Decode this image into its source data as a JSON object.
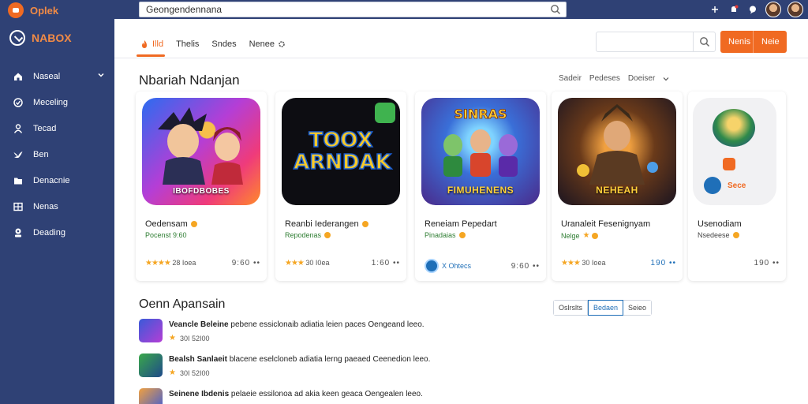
{
  "topbar": {
    "brand": "Oplek",
    "search_value": "Geongendennana",
    "icons": [
      "pin-icon",
      "bell-icon",
      "chat-icon",
      "avatar",
      "avatar"
    ]
  },
  "sidebar": {
    "brand": "NABOX",
    "items": [
      {
        "label": "Naseal",
        "icon": "house-icon",
        "caret": true
      },
      {
        "label": "Meceling",
        "icon": "circle-check-icon"
      },
      {
        "label": "Tecad",
        "icon": "people-icon"
      },
      {
        "label": "Ben",
        "icon": "bird-icon"
      },
      {
        "label": "Denacnie",
        "icon": "folder-icon"
      },
      {
        "label": "Nenas",
        "icon": "grid-icon"
      },
      {
        "label": "Deading",
        "icon": "person-icon"
      }
    ]
  },
  "header": {
    "tabs": [
      {
        "label": "Illd",
        "active": true
      },
      {
        "label": "Thelis"
      },
      {
        "label": "Sndes"
      },
      {
        "label": "Nenee"
      }
    ],
    "search_placeholder": "",
    "buttons": [
      "Nenis",
      "Neie"
    ]
  },
  "section1": {
    "title": "Nbariah Ndanjan",
    "sort": [
      "Sadeir",
      "Pedeses",
      "Doeiser"
    ],
    "cards": [
      {
        "img_text": "IBOFDBOBES",
        "title": "Oedensam",
        "sub": "Pocenst  9:60",
        "stars": "★★★★",
        "foot_left": "28 Ioea",
        "foot_right": "9:60 ••"
      },
      {
        "img_text": "TOOX ARNDAK",
        "title": "Reanbi Iederangen",
        "sub": "Repodenas",
        "stars": "★★★",
        "foot_left": "30 I0ea",
        "foot_right": "1:60 ••"
      },
      {
        "img_text": "FIMUHENENS",
        "title": "Reneiam Pepedart",
        "sub": "Pinadaias",
        "stars": "",
        "foot_left": "X Ohtecs",
        "foot_right": "9:60 ••"
      },
      {
        "img_text": "NEHEAH",
        "title": "Uranaleit Fesenignyam",
        "sub": "Nelge",
        "stars": "★★★",
        "foot_left": "30 Ioea",
        "foot_right": "190 ••"
      },
      {
        "img_text": "Sece",
        "title": "Usenodiam",
        "sub": "Nsedeese",
        "stars": "",
        "foot_left": "",
        "foot_right": "190 ••"
      }
    ]
  },
  "section2": {
    "title": "Oenn Apansain",
    "filters": [
      "Oslrslts",
      "Bedaen",
      "Seieo"
    ],
    "active_filter": 1,
    "items": [
      {
        "bold": "Veancle Beleine",
        "text": "pebene essiclonaib adiatia leien paces Oengeand leeo.",
        "meta": "30I 52I00",
        "star": true
      },
      {
        "bold": "Bealsh Sanlaeit",
        "text": "blacene eselcloneb adiatia lerng paeaed Ceenedion leeo.",
        "meta": "30I 52I00",
        "star": true
      },
      {
        "bold": "Seinene Ibdenis",
        "text": "pelaeie essilonoa ad akia keen geaca Oengealen leeo.",
        "meta": "",
        "star": false
      }
    ]
  },
  "colors": {
    "sidebar": "#2f4175",
    "accent": "#f06a22",
    "green": "#2e7d32",
    "star": "#f5a623"
  }
}
